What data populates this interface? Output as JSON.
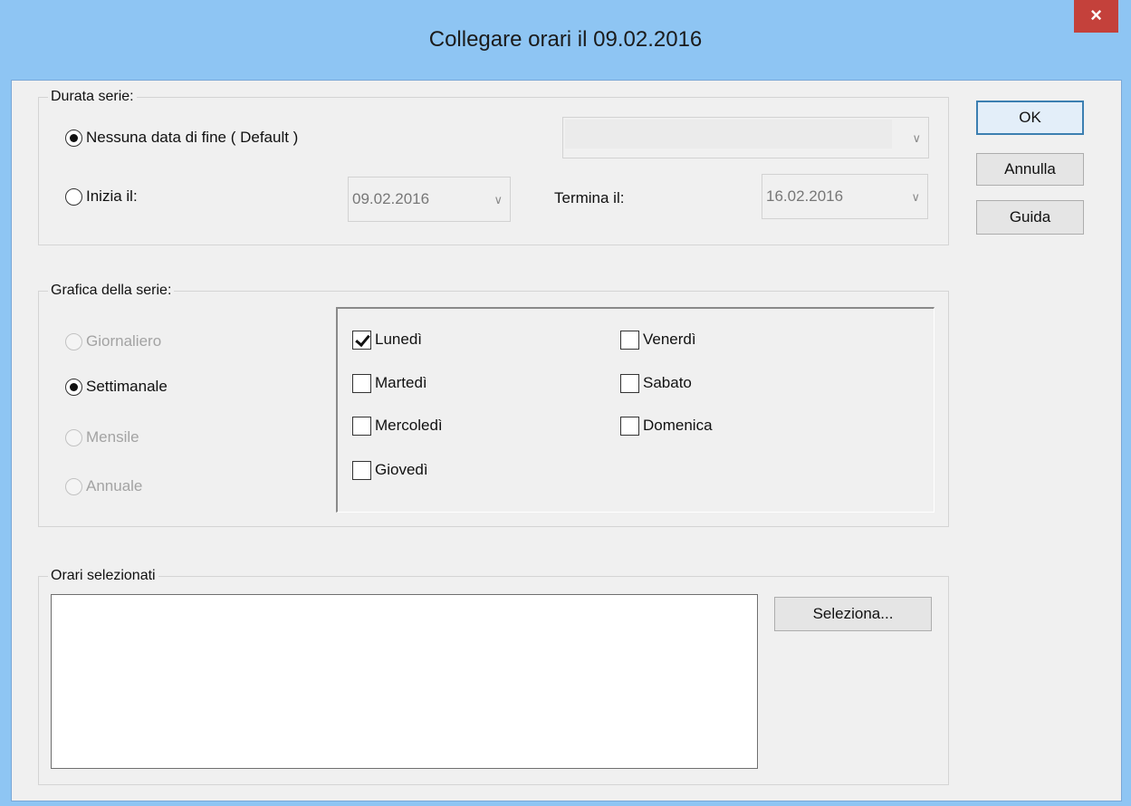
{
  "window": {
    "title": "Collegare orari il 09.02.2016",
    "close_glyph": "×"
  },
  "duration": {
    "legend": "Durata serie:",
    "no_end_label": "Nessuna data di fine ( Default )",
    "no_end_value": "",
    "starts_label": "Inizia il:",
    "start_date": "09.02.2016",
    "ends_label": "Termina il:",
    "end_date": "16.02.2016",
    "selected": "no_end"
  },
  "pattern": {
    "legend": "Grafica della serie:",
    "options": {
      "daily": "Giornaliero",
      "weekly": "Settimanale",
      "monthly": "Mensile",
      "yearly": "Annuale"
    },
    "selected": "weekly",
    "days": {
      "monday": "Lunedì",
      "tuesday": "Martedì",
      "wednesday": "Mercoledì",
      "thursday": "Giovedì",
      "friday": "Venerdì",
      "saturday": "Sabato",
      "sunday": "Domenica"
    },
    "checked_days": [
      "monday"
    ]
  },
  "selected_times": {
    "legend": "Orari selezionati",
    "select_button": "Seleziona..."
  },
  "buttons": {
    "ok": "OK",
    "cancel": "Annulla",
    "help": "Guida"
  },
  "icons": {
    "dropdown": "chevron-down-icon",
    "close": "close-icon",
    "check": "checkmark-icon"
  },
  "colors": {
    "titlebar": "#8ec5f3",
    "close": "#c4413b",
    "dialog_bg": "#f0f0f0",
    "default_button_border": "#3c7fb1"
  }
}
